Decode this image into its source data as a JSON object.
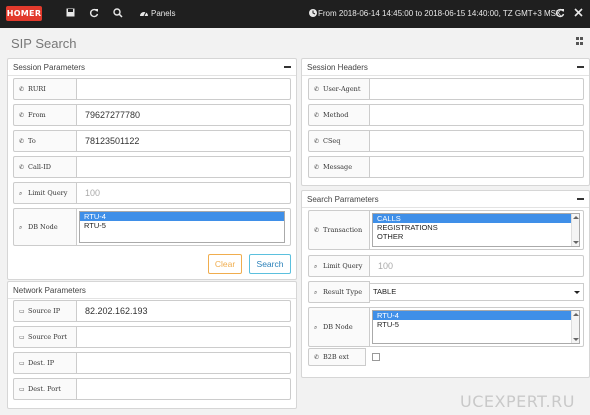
{
  "topbar": {
    "logo": "HOMER",
    "panels_label": "Panels",
    "time_range": "From 2018-06-14 14:45:00 to 2018-06-15 14:40:00, TZ GMT+3 MSK",
    "icons": [
      "save-icon",
      "refresh-icon",
      "search-icon",
      "dashboard-icon",
      "clock-icon",
      "reload-icon",
      "close-icon"
    ]
  },
  "page": {
    "title": "SIP Search"
  },
  "session_parameters": {
    "title": "Session Parameters",
    "fields": [
      {
        "label": "RURI",
        "value": "",
        "placeholder": ""
      },
      {
        "label": "From",
        "value": "79627277780",
        "placeholder": ""
      },
      {
        "label": "To",
        "value": "78123501122",
        "placeholder": ""
      },
      {
        "label": "Call-ID",
        "value": "",
        "placeholder": ""
      },
      {
        "label": "Limit Query",
        "value": "",
        "placeholder": "100"
      }
    ],
    "db_node": {
      "label": "DB Node",
      "options": [
        "RTU-4",
        "RTU-5"
      ],
      "selected": "RTU-4"
    },
    "clear_label": "Clear",
    "search_label": "Search"
  },
  "network_parameters": {
    "title": "Network Parameters",
    "fields": [
      {
        "label": "Source IP",
        "value": "82.202.162.193"
      },
      {
        "label": "Source Port",
        "value": ""
      },
      {
        "label": "Dest. IP",
        "value": ""
      },
      {
        "label": "Dest. Port",
        "value": ""
      }
    ]
  },
  "session_headers": {
    "title": "Session Headers",
    "fields": [
      {
        "label": "User-Agent",
        "value": ""
      },
      {
        "label": "Method",
        "value": ""
      },
      {
        "label": "CSeq",
        "value": ""
      },
      {
        "label": "Message",
        "value": ""
      }
    ]
  },
  "search_parameters": {
    "title": "Search Parrameters",
    "transaction": {
      "label": "Transaction",
      "options": [
        "CALLS",
        "REGISTRATIONS",
        "OTHER"
      ],
      "selected": "CALLS"
    },
    "limit_query": {
      "label": "Limit Query",
      "placeholder": "100"
    },
    "result_type": {
      "label": "Result Type",
      "value": "TABLE"
    },
    "db_node": {
      "label": "DB Node",
      "options": [
        "RTU-4",
        "RTU-5"
      ],
      "selected": "RTU-4"
    },
    "b2b_ext": {
      "label": "B2B ext",
      "checked": false
    }
  },
  "watermark": "UCEXPERT.RU",
  "colors": {
    "topbar": "#1f1f1f",
    "logo": "#e23a2c",
    "selection": "#3f8fe8",
    "clear": "#f0ad4e",
    "search": "#5bc0de"
  }
}
